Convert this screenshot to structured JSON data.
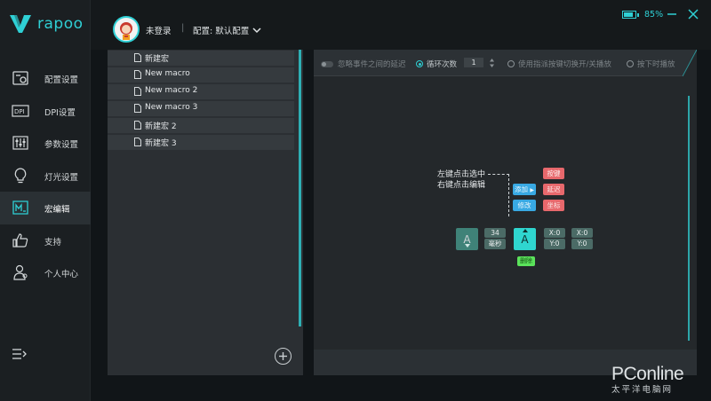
{
  "app": {
    "logo_text": "rapoo",
    "accent_color": "#2fd0d5"
  },
  "sidebar": {
    "items": [
      {
        "label": "配置设置",
        "icon": "config-icon"
      },
      {
        "label": "DPI设置",
        "icon": "dpi-icon"
      },
      {
        "label": "参数设置",
        "icon": "sliders-icon"
      },
      {
        "label": "灯光设置",
        "icon": "bulb-icon"
      },
      {
        "label": "宏编辑",
        "icon": "macro-icon",
        "active": true
      },
      {
        "label": "支持",
        "icon": "thumbs-up-icon"
      },
      {
        "label": "个人中心",
        "icon": "user-icon"
      }
    ],
    "menu_icon": "collapse-menu-icon"
  },
  "header": {
    "user_label": "未登录",
    "separator": "|",
    "config_label": "配置: 默认配置",
    "battery_percent": "85%",
    "battery_level": 0.85
  },
  "macro_list": {
    "items": [
      "新建宏",
      "New macro",
      "New macro 2",
      "New macro 3",
      "新建宏 2",
      "新建宏 3"
    ]
  },
  "editor": {
    "toolbar": {
      "ignore_delay_label": "忽略事件之间的延迟",
      "loop_label": "循环次数",
      "loop_count": "1",
      "toggle_play_label": "使用指派按键切换开/关播放",
      "hold_play_label": "按下时播放"
    },
    "hint_line1": "左键点击选中",
    "hint_line2": "右键点击编辑",
    "blocks": {
      "key_a_left": "A",
      "delay_value": "34",
      "delay_unit": "毫秒",
      "key_a_selected": "A",
      "pos1_x": "X:0",
      "pos1_y": "Y:0",
      "pos2_x": "X:0",
      "pos2_y": "Y:0",
      "menu_add": "添加",
      "menu_modify": "修改",
      "menu_delete": "删除",
      "sub_key": "按键",
      "sub_delay": "延迟",
      "sub_coord": "坐标"
    }
  },
  "watermark": {
    "big": "PConline",
    "small": "太平洋电脑网"
  }
}
